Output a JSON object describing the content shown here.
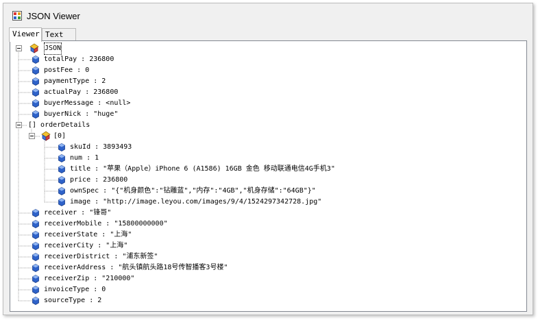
{
  "window": {
    "title": "JSON Viewer"
  },
  "tabs": [
    {
      "label": "Viewer",
      "active": true
    },
    {
      "label": "Text",
      "active": false
    }
  ],
  "tree": {
    "root_label": "JSON",
    "nodes": [
      {
        "kind": "leaf",
        "depth": 1,
        "text": "totalPay : 236800"
      },
      {
        "kind": "leaf",
        "depth": 1,
        "text": "postFee : 0"
      },
      {
        "kind": "leaf",
        "depth": 1,
        "text": "paymentType : 2"
      },
      {
        "kind": "leaf",
        "depth": 1,
        "text": "actualPay : 236800"
      },
      {
        "kind": "leaf",
        "depth": 1,
        "text": "buyerMessage : <null>"
      },
      {
        "kind": "leaf",
        "depth": 1,
        "text": "buyerNick : \"huge\""
      },
      {
        "kind": "array",
        "depth": 1,
        "text": "[] orderDetails",
        "expanded": true
      },
      {
        "kind": "object",
        "depth": 2,
        "text": "[0]",
        "expanded": true
      },
      {
        "kind": "leaf",
        "depth": 3,
        "text": "skuId : 3893493"
      },
      {
        "kind": "leaf",
        "depth": 3,
        "text": "num : 1"
      },
      {
        "kind": "leaf",
        "depth": 3,
        "text": "title : \"苹果（Apple）iPhone 6 (A1586) 16GB 金色 移动联通电信4G手机3\""
      },
      {
        "kind": "leaf",
        "depth": 3,
        "text": "price : 236800"
      },
      {
        "kind": "leaf",
        "depth": 3,
        "text": "ownSpec : \"{\"机身颜色\":\"钻雕蓝\",\"内存\":\"4GB\",\"机身存储\":\"64GB\"}\""
      },
      {
        "kind": "leaf",
        "depth": 3,
        "text": "image : \"http://image.leyou.com/images/9/4/1524297342728.jpg\""
      },
      {
        "kind": "leaf",
        "depth": 1,
        "text": "receiver : \"锋哥\""
      },
      {
        "kind": "leaf",
        "depth": 1,
        "text": "receiverMobile : \"15800000000\""
      },
      {
        "kind": "leaf",
        "depth": 1,
        "text": "receiverState : \"上海\""
      },
      {
        "kind": "leaf",
        "depth": 1,
        "text": "receiverCity : \"上海\""
      },
      {
        "kind": "leaf",
        "depth": 1,
        "text": "receiverDistrict : \"浦东新签\""
      },
      {
        "kind": "leaf",
        "depth": 1,
        "text": "receiverAddress : \"航头镇航头路18号传智播客3号楼\""
      },
      {
        "kind": "leaf",
        "depth": 1,
        "text": "receiverZip : \"210000\""
      },
      {
        "kind": "leaf",
        "depth": 1,
        "text": "invoiceType : 0"
      },
      {
        "kind": "leaf",
        "depth": 1,
        "text": "sourceType : 2"
      }
    ]
  },
  "colors": {
    "leaf_icon": "#2e62c9",
    "tree_lines": "#a0a0a0",
    "frame": "#f0f0f0"
  }
}
